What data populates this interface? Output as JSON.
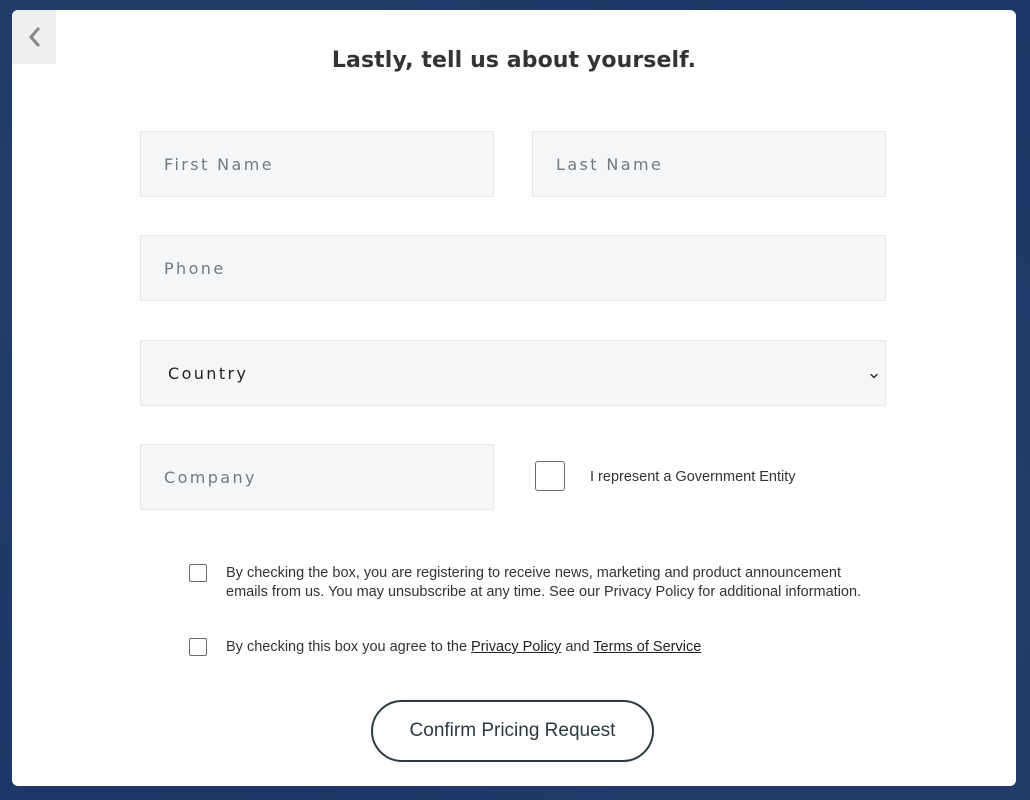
{
  "page": {
    "title": "Lastly, tell us about yourself."
  },
  "nav": {
    "back_icon": "chevron-left-icon"
  },
  "form": {
    "first_name": {
      "placeholder": "First Name",
      "value": ""
    },
    "last_name": {
      "placeholder": "Last Name",
      "value": ""
    },
    "phone": {
      "placeholder": "Phone",
      "value": ""
    },
    "country": {
      "selected": "Country",
      "icon": "chevron-down-icon"
    },
    "company": {
      "placeholder": "Company",
      "value": ""
    },
    "government": {
      "label": "I represent a Government Entity",
      "checked": false
    }
  },
  "consent": {
    "marketing": {
      "text": "By checking the box, you are registering to receive news, marketing and product announcement emails from us. You may unsubscribe at any time. See our Privacy Policy for additional information.",
      "checked": false
    },
    "agree": {
      "prefix": "By checking this box you agree to the ",
      "privacy_link": "Privacy Policy",
      "middle": " and ",
      "terms_link": "Terms of Service",
      "checked": false
    }
  },
  "actions": {
    "confirm_label": "Confirm Pricing Request"
  },
  "colors": {
    "background": "#1d3766",
    "field_bg": "#f4f6f8",
    "button_border": "#2a3a40"
  }
}
